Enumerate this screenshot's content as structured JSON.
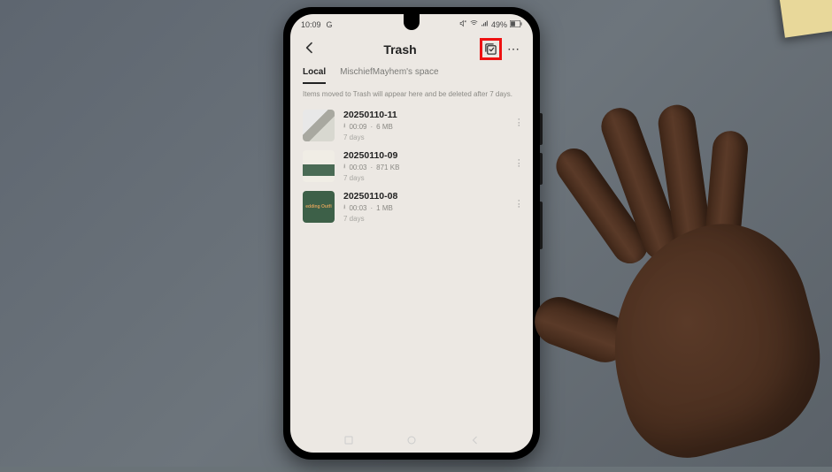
{
  "statusbar": {
    "time": "10:09",
    "time_extra": "G",
    "battery_text": "49%"
  },
  "header": {
    "title": "Trash"
  },
  "tabs": [
    {
      "label": "Local",
      "active": true
    },
    {
      "label": "MischiefMayhem's space",
      "active": false
    }
  ],
  "info_text": "Items moved to Trash will appear here and be deleted after 7 days.",
  "items": [
    {
      "title": "20250110-11",
      "duration": "00:09",
      "size": "6 MB",
      "age": "7 days"
    },
    {
      "title": "20250110-09",
      "duration": "00:03",
      "size": "871 KB",
      "age": "7 days"
    },
    {
      "title": "20250110-08",
      "duration": "00:03",
      "size": "1 MB",
      "age": "7 days"
    }
  ],
  "thumb3_overlay": "edding Outfi"
}
